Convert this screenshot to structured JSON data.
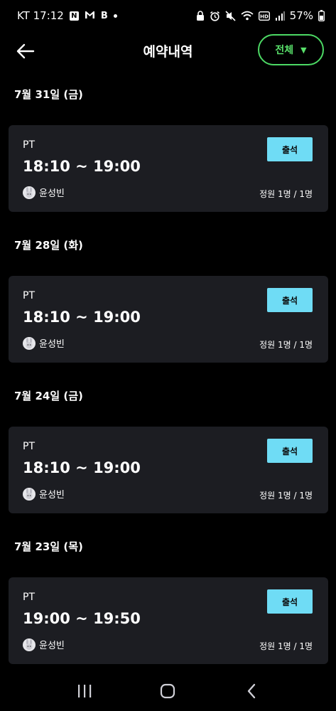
{
  "status_bar": {
    "carrier_time": "KT 17:12",
    "notif_n": "N",
    "notif_b": "B",
    "battery": "57%",
    "icons": [
      "naver-icon",
      "gmail-icon",
      "b-app-icon",
      "dot-icon",
      "lock-icon",
      "alarm-icon",
      "mute-icon",
      "wifi-icon",
      "hd-icon",
      "signal-icon",
      "battery-icon"
    ]
  },
  "header": {
    "title": "예약내역",
    "filter_label": "전체",
    "filter_arrow": "▼"
  },
  "reservations": [
    {
      "date": "7월 31일 (금)",
      "type": "PT",
      "time": "18:10 ~ 19:00",
      "instructor": "윤성빈",
      "capacity": "정원 1명 / 1명",
      "status_label": "출석"
    },
    {
      "date": "7월 28일 (화)",
      "type": "PT",
      "time": "18:10 ~ 19:00",
      "instructor": "윤성빈",
      "capacity": "정원 1명 / 1명",
      "status_label": "출석"
    },
    {
      "date": "7월 24일 (금)",
      "type": "PT",
      "time": "18:10 ~ 19:00",
      "instructor": "윤성빈",
      "capacity": "정원 1명 / 1명",
      "status_label": "출석"
    },
    {
      "date": "7월 23일 (목)",
      "type": "PT",
      "time": "19:00 ~ 19:50",
      "instructor": "윤성빈",
      "capacity": "정원 1명 / 1명",
      "status_label": "출석"
    }
  ],
  "colors": {
    "background": "#000000",
    "card": "#1c1d22",
    "accent_green": "#4cd964",
    "attend_button": "#6fdcf5"
  }
}
